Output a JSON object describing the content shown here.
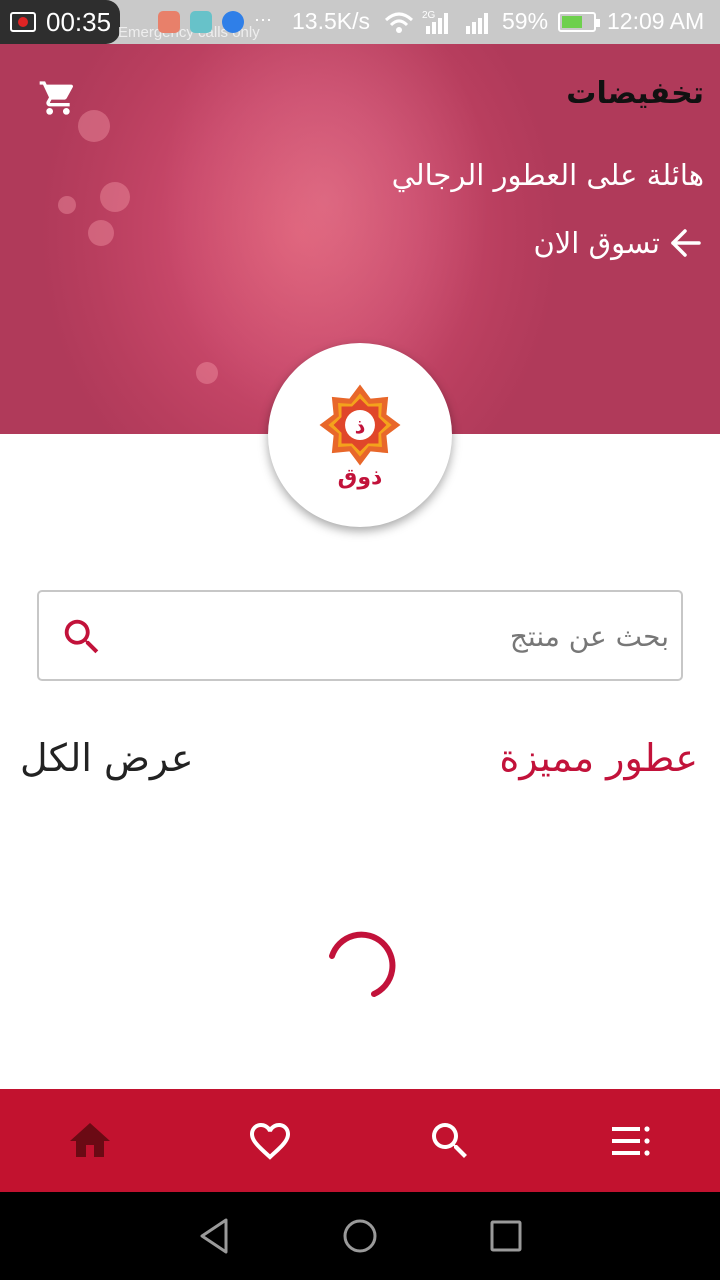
{
  "status_bar": {
    "recording_time": "00:35",
    "carrier_text": "Emergency calls only",
    "network_speed": "13.5K/s",
    "network_type": "2G",
    "battery_percent": "59%",
    "clock": "12:09 AM"
  },
  "hero": {
    "title": "تخفيضات",
    "subtitle": "هائلة على العطور الرجالي",
    "cta_label": "تسوق الان"
  },
  "logo": {
    "letter": "ذ",
    "wordmark": "ذوق",
    "colors": {
      "outer": "#e8672a",
      "inner": "#f4a21c",
      "center": "#ffffff",
      "letter": "#c2123a"
    }
  },
  "search": {
    "placeholder": "بحث عن منتج",
    "value": ""
  },
  "featured": {
    "title": "عطور مميزة",
    "view_all_label": "عرض الكل",
    "loading": true
  },
  "bottom_nav": {
    "items": [
      {
        "icon": "home-icon",
        "active": true
      },
      {
        "icon": "heart-icon",
        "active": false
      },
      {
        "icon": "search-icon",
        "active": false
      },
      {
        "icon": "menu-icon",
        "active": false
      }
    ]
  },
  "colors": {
    "brand": "#c2122f",
    "accent": "#c2123a",
    "hero_bg": "#c9486a",
    "active_nav_icon": "#6b0a14"
  }
}
